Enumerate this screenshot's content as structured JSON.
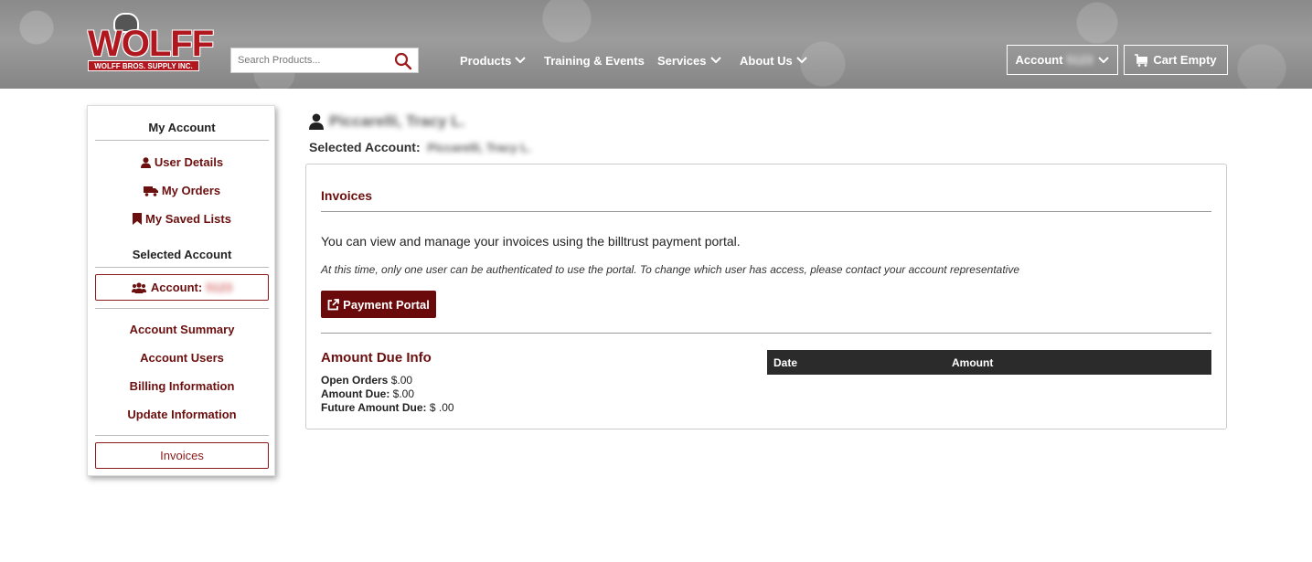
{
  "header": {
    "logo": {
      "word": "WOLFF",
      "tagline": "WOLFF BROS. SUPPLY INC."
    },
    "search": {
      "placeholder": "Search Products..."
    },
    "nav": [
      {
        "label": "Products",
        "has_dropdown": true
      },
      {
        "label": "Training & Events",
        "has_dropdown": false
      },
      {
        "label": "Services",
        "has_dropdown": true
      },
      {
        "label": "About Us",
        "has_dropdown": true
      }
    ],
    "account_button": {
      "label": "Account",
      "number": "5123"
    },
    "cart_button": {
      "label": "Cart Empty"
    }
  },
  "sidebar": {
    "my_account_heading": "My Account",
    "links_top": [
      {
        "label": "User Details",
        "icon": "user-icon"
      },
      {
        "label": "My Orders",
        "icon": "truck-icon"
      },
      {
        "label": "My Saved Lists",
        "icon": "bookmark-icon"
      }
    ],
    "selected_account_heading": "Selected Account",
    "account_box": {
      "label": "Account:",
      "number": "5123"
    },
    "links_bottom": [
      {
        "label": "Account Summary"
      },
      {
        "label": "Account Users"
      },
      {
        "label": "Billing Information"
      },
      {
        "label": "Update Information"
      }
    ],
    "active_link": "Invoices"
  },
  "main": {
    "user_name": "Piccarelli, Tracy L.",
    "selected_account_label": "Selected Account:",
    "selected_account_value": "Piccarelli, Tracy L.",
    "card": {
      "title": "Invoices",
      "intro": "You can view and manage your invoices using the billtrust payment portal.",
      "note": "At this time, only one user can be authenticated to use the portal. To change which user has access, please contact your account representative",
      "payment_button": "Payment Portal",
      "amount_due_title": "Amount Due Info",
      "open_orders": {
        "label": "Open Orders",
        "value": "$.00"
      },
      "amount_due": {
        "label": "Amount Due:",
        "value": "$.00"
      },
      "future_amount_due": {
        "label": "Future Amount Due:",
        "value": "$ .00"
      },
      "table_headers": [
        "Date",
        "Amount"
      ]
    }
  },
  "colors": {
    "brand_red": "#b0171f",
    "maroon": "#6b0f0f",
    "table_header": "#2b2b2b"
  }
}
